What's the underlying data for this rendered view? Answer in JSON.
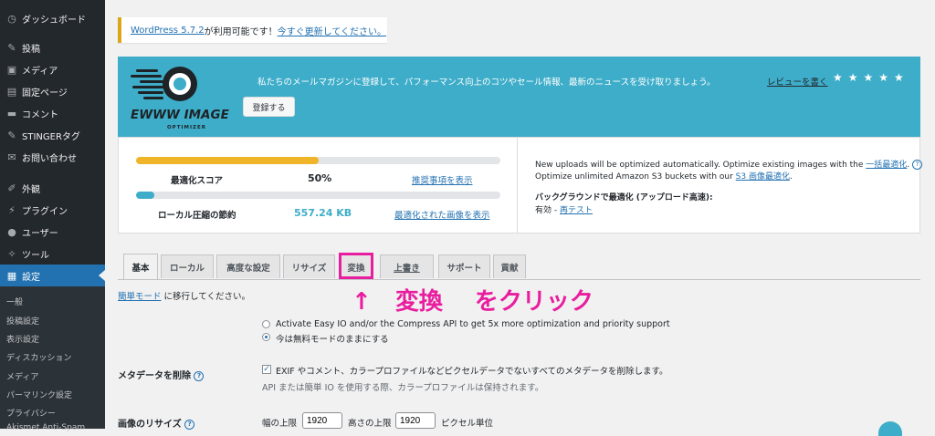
{
  "sidebar": {
    "items": [
      {
        "icon": "dashboard-icon",
        "glyph": "◷",
        "label": "ダッシュボード"
      },
      {
        "icon": "pin-icon",
        "glyph": "✎",
        "label": "投稿"
      },
      {
        "icon": "media-icon",
        "glyph": "▣",
        "label": "メディア"
      },
      {
        "icon": "page-icon",
        "glyph": "▤",
        "label": "固定ページ"
      },
      {
        "icon": "comment-icon",
        "glyph": "▬",
        "label": "コメント"
      },
      {
        "icon": "pin-icon",
        "glyph": "✎",
        "label": "STINGERタグ"
      },
      {
        "icon": "mail-icon",
        "glyph": "✉",
        "label": "お問い合わせ"
      },
      {
        "icon": "appearance-icon",
        "glyph": "✐",
        "label": "外観"
      },
      {
        "icon": "plugin-icon",
        "glyph": "⚡",
        "label": "プラグイン"
      },
      {
        "icon": "user-icon",
        "glyph": "●",
        "label": "ユーザー"
      },
      {
        "icon": "tools-icon",
        "glyph": "✧",
        "label": "ツール"
      },
      {
        "icon": "settings-icon",
        "glyph": "▦",
        "label": "設定"
      }
    ],
    "submenu": [
      "一般",
      "投稿設定",
      "表示設定",
      "ディスカッション",
      "メディア",
      "パーマリンク設定",
      "プライバシー",
      "Akismet Anti-Spam"
    ]
  },
  "notice": {
    "link1": "WordPress 5.7.2",
    "text": " が利用可能です！",
    "link2": "今すぐ更新してください。"
  },
  "banner": {
    "logo_title": "EWWW IMAGE",
    "logo_sub": "OPTIMIZER",
    "text": "私たちのメールマガジンに登録して、パフォーマンス向上のコツやセール情報、最新のニュースを受け取りましょう。",
    "signup_button": "登録する",
    "review_link": "レビューを書く",
    "stars": "★★★★★"
  },
  "stats": {
    "score_label": "最適化スコア",
    "score_value": "50%",
    "score_fraction": 0.5,
    "score_link": "推奨事項を表示",
    "saving_label": "ローカル圧縮の節約",
    "saving_value": "557.24 KB",
    "saving_fraction": 0.05,
    "saving_link": "最適化された画像を表示",
    "right_line1_a": "New uploads will be optimized automatically. Optimize existing images with the ",
    "right_line1_link": "一括最適化",
    "right_line1_b": ".",
    "right_line2_a": "Optimize unlimited Amazon S3 buckets with our ",
    "right_line2_link": "S3 画像最適化",
    "right_line2_b": ".",
    "bg_title": "バックグラウンドで最適化 (アップロード高速):",
    "bg_status": "有効 - ",
    "bg_link": "再テスト",
    "colors": {
      "score": "#f0b429",
      "saving": "#3eadc9"
    }
  },
  "tabs": [
    "基本",
    "ローカル",
    "高度な設定",
    "リサイズ",
    "変換",
    "上書き",
    "サポート",
    "貢献"
  ],
  "annotation": {
    "arrow": "↑",
    "text": "変換　 をクリック"
  },
  "form": {
    "easy_mode_link": "簡単モード",
    "easy_mode_text": " に移行してください。",
    "radio1": "Activate Easy IO and/or the Compress API to get 5x more optimization and priority support",
    "radio2": "今は無料モードのままにする",
    "metadata_label": "メタデータを削除",
    "metadata_check": "EXIF やコメント、カラープロファイルなどピクセルデータでないすべてのメタデータを削除します。",
    "metadata_note": "API または簡単 IO を使用する際、カラープロファイルは保持されます。",
    "resize_label": "画像のリサイズ",
    "width_label": "幅の上限",
    "width_value": "1920",
    "height_label": "高さの上限",
    "height_value": "1920",
    "unit": "ピクセル単位"
  }
}
